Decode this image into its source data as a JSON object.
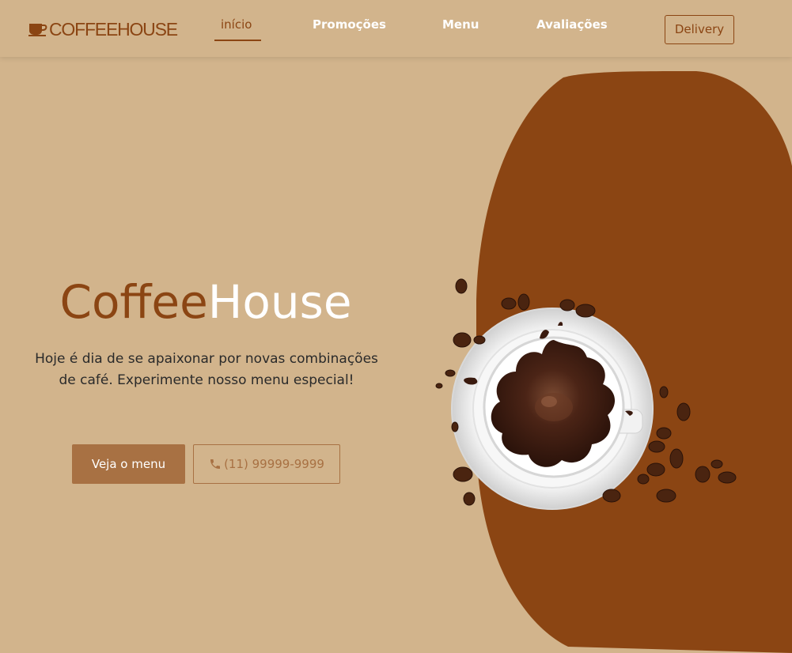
{
  "brand": {
    "logo_text": "COFFEEHOUSE",
    "logo_icon": "coffee-cup-icon"
  },
  "nav": {
    "items": [
      {
        "label": "início",
        "active": true
      },
      {
        "label": "Promoções",
        "active": false
      },
      {
        "label": "Menu",
        "active": false
      },
      {
        "label": "Avaliações",
        "active": false
      }
    ],
    "delivery_label": "Delivery"
  },
  "hero": {
    "title_part1": "Coffee",
    "title_part2": "House",
    "description": "Hoje é dia de se apaixonar por novas combinações de café. Experimente nosso menu especial!",
    "menu_button": "Veja o menu",
    "phone_button": "(11) 99999-9999",
    "phone_icon": "phone-icon"
  },
  "colors": {
    "background": "#d2b48c",
    "accent": "#8b4513",
    "button": "#a87143",
    "white": "#ffffff"
  }
}
